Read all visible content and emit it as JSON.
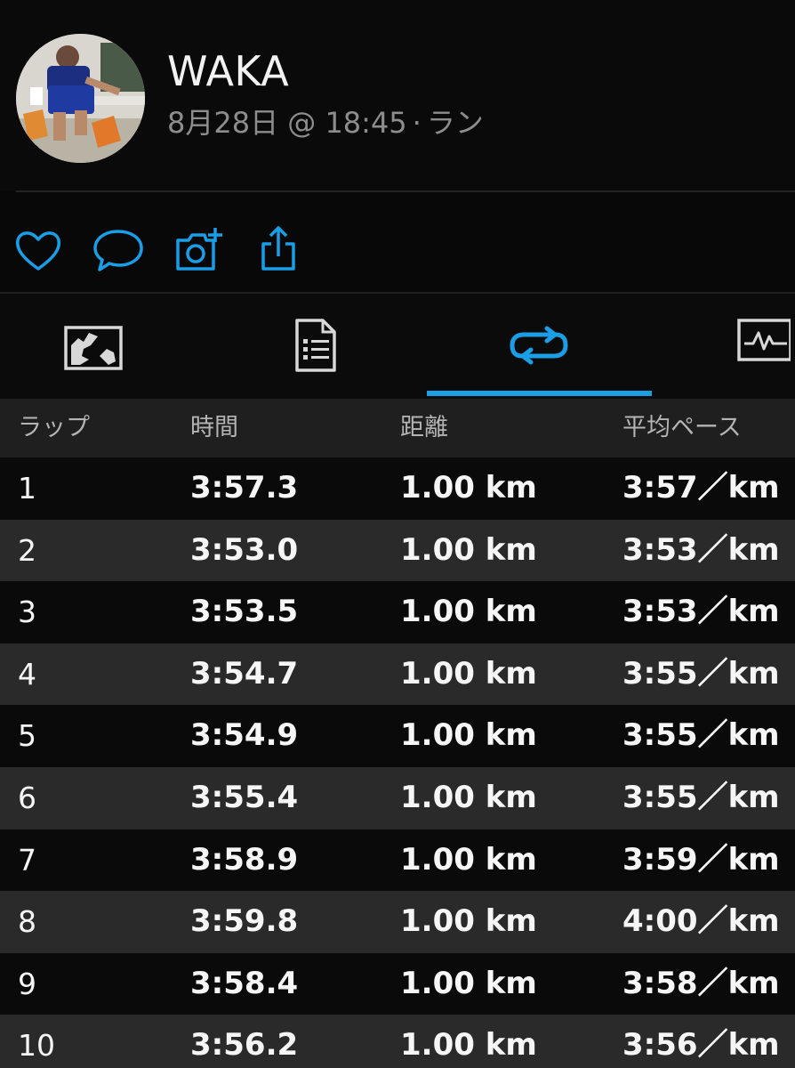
{
  "user": {
    "name": "WAKA",
    "date": "8月28日",
    "time": "@ 18:45",
    "separator": "·",
    "activity": "ラン"
  },
  "actions": [
    {
      "name": "like",
      "icon": "heart-icon"
    },
    {
      "name": "comment",
      "icon": "speech-bubble-icon"
    },
    {
      "name": "add-photo",
      "icon": "camera-plus-icon"
    },
    {
      "name": "share",
      "icon": "share-icon"
    }
  ],
  "tabs": [
    {
      "name": "map",
      "icon": "map-icon",
      "active": false
    },
    {
      "name": "stats",
      "icon": "document-list-icon",
      "active": false
    },
    {
      "name": "laps",
      "icon": "loop-arrows-icon",
      "active": true
    },
    {
      "name": "charts",
      "icon": "waveform-chart-icon",
      "active": false
    }
  ],
  "colors": {
    "accent": "#1a9ee6",
    "background": "#070707",
    "row_dark": "#0a0a0a",
    "row_light": "#2a2a2a",
    "header_bg": "#1f1f1f",
    "secondary_text": "#8d8d8d"
  },
  "table": {
    "headers": {
      "lap": "ラップ",
      "time": "時間",
      "distance": "距離",
      "pace": "平均ペース"
    },
    "rows": [
      {
        "lap": "1",
        "time": "3:57.3",
        "distance": "1.00 km",
        "pace": "3:57／km"
      },
      {
        "lap": "2",
        "time": "3:53.0",
        "distance": "1.00 km",
        "pace": "3:53／km"
      },
      {
        "lap": "3",
        "time": "3:53.5",
        "distance": "1.00 km",
        "pace": "3:53／km"
      },
      {
        "lap": "4",
        "time": "3:54.7",
        "distance": "1.00 km",
        "pace": "3:55／km"
      },
      {
        "lap": "5",
        "time": "3:54.9",
        "distance": "1.00 km",
        "pace": "3:55／km"
      },
      {
        "lap": "6",
        "time": "3:55.4",
        "distance": "1.00 km",
        "pace": "3:55／km"
      },
      {
        "lap": "7",
        "time": "3:58.9",
        "distance": "1.00 km",
        "pace": "3:59／km"
      },
      {
        "lap": "8",
        "time": "3:59.8",
        "distance": "1.00 km",
        "pace": "4:00／km"
      },
      {
        "lap": "9",
        "time": "3:58.4",
        "distance": "1.00 km",
        "pace": "3:58／km"
      },
      {
        "lap": "10",
        "time": "3:56.2",
        "distance": "1.00 km",
        "pace": "3:56／km"
      }
    ]
  }
}
